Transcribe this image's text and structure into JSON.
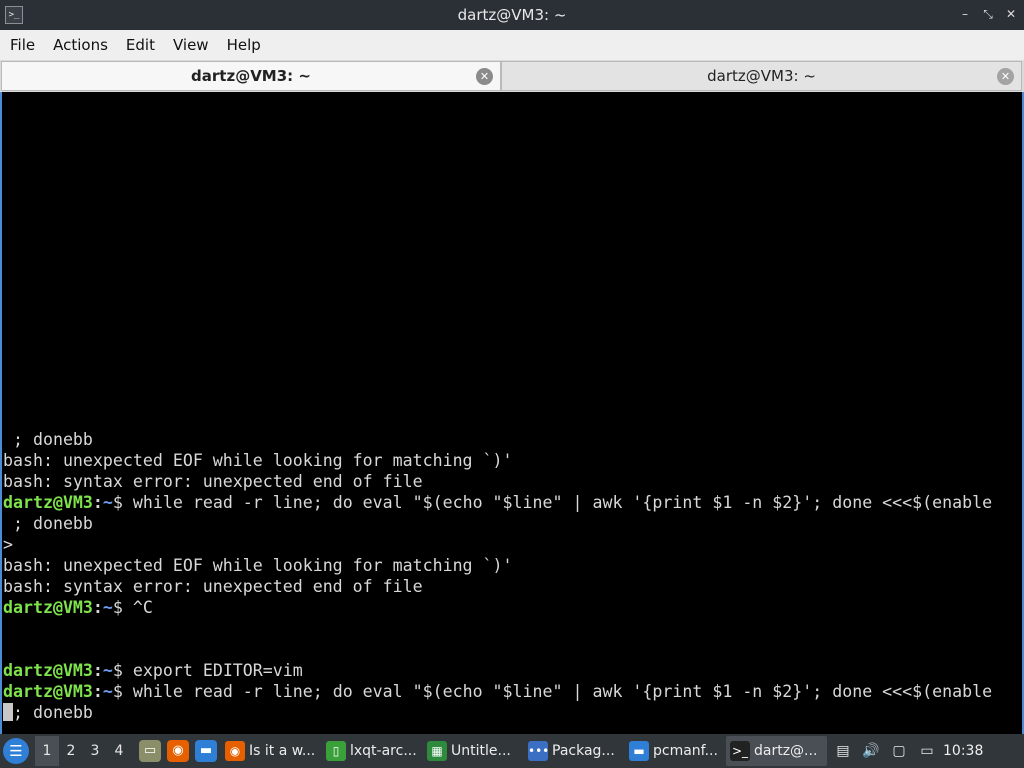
{
  "window": {
    "title": "dartz@VM3: ~",
    "app_icon_glyph": ">_",
    "buttons": {
      "minimize": "–",
      "maximize": "⤡",
      "close": "✕"
    }
  },
  "menu": [
    "File",
    "Actions",
    "Edit",
    "View",
    "Help"
  ],
  "tabs": [
    {
      "label": "dartz@VM3: ~",
      "active": true
    },
    {
      "label": "dartz@VM3: ~",
      "active": false
    }
  ],
  "terminal": {
    "prompt": {
      "user": "dartz@VM3",
      "sep": ":",
      "path": "~",
      "symbol": "$ "
    },
    "lines": [
      {
        "text": " ; donebb"
      },
      {
        "text": "bash: unexpected EOF while looking for matching `)'"
      },
      {
        "text": "bash: syntax error: unexpected end of file"
      },
      {
        "prompt": true,
        "text": "while read -r line; do eval \"$(echo \"$line\" | awk '{print $1 -n $2}'; done <<<$(enable"
      },
      {
        "text": " ; donebb"
      },
      {
        "text": ">"
      },
      {
        "text": "bash: unexpected EOF while looking for matching `)'"
      },
      {
        "text": "bash: syntax error: unexpected end of file"
      },
      {
        "prompt": true,
        "text": "^C"
      },
      {
        "text": ""
      },
      {
        "text": ""
      },
      {
        "prompt": true,
        "text": "export EDITOR=vim"
      },
      {
        "prompt": true,
        "text": "while read -r line; do eval \"$(echo \"$line\" | awk '{print $1 -n $2}'; done <<<$(enable"
      },
      {
        "cursor": true,
        "text": "; donebb"
      }
    ]
  },
  "taskbar": {
    "start_icon": "menu-icon",
    "desktops": [
      "1",
      "2",
      "3",
      "4"
    ],
    "quick_launch": [
      {
        "name": "show-desktop-icon",
        "glyph": "▭",
        "color": "#8a8f6a"
      },
      {
        "name": "firefox-icon",
        "glyph": "◉",
        "color": "#e66000"
      },
      {
        "name": "folder-icon",
        "glyph": "▬",
        "color": "#2f7fd6"
      }
    ],
    "tasks": [
      {
        "label": "Is it a w...",
        "icon": "firefox-icon",
        "color": "#e66000",
        "glyph": "◉"
      },
      {
        "label": "lxqt-arc...",
        "icon": "text-file-icon",
        "color": "#3aa13a",
        "glyph": "▯"
      },
      {
        "label": "Untitle...",
        "icon": "spreadsheet-icon",
        "color": "#2e8b3e",
        "glyph": "▦"
      },
      {
        "label": "Packag...",
        "icon": "package-icon",
        "color": "#3a6fc4",
        "glyph": "•••"
      },
      {
        "label": "pcmanf...",
        "icon": "file-manager-icon",
        "color": "#2f7fd6",
        "glyph": "▬"
      },
      {
        "label": "dartz@...",
        "icon": "terminal-icon",
        "color": "#222",
        "glyph": ">_",
        "active": true
      }
    ],
    "tray": [
      {
        "name": "clipboard-icon",
        "glyph": "▤"
      },
      {
        "name": "volume-icon",
        "glyph": "🔊"
      },
      {
        "name": "notes-icon",
        "glyph": "▢"
      },
      {
        "name": "network-icon",
        "glyph": "▭"
      }
    ],
    "clock": "10:38"
  }
}
